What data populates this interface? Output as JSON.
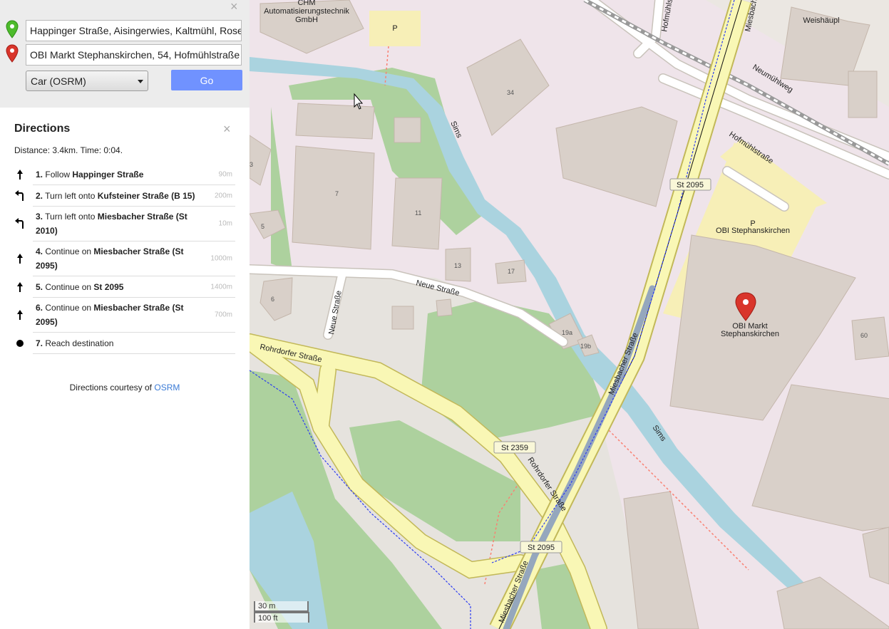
{
  "route_form": {
    "from_value": "Happinger Straße, Aisingerwies, Kaltmühl, Rosenheim",
    "to_value": "OBI Markt Stephanskirchen, 54, Hofmühlstraße",
    "engine_selected": "Car (OSRM)",
    "go_label": "Go",
    "close_symbol": "×"
  },
  "directions": {
    "title": "Directions",
    "close_symbol": "×",
    "summary": "Distance: 3.4km. Time: 0:04.",
    "steps": [
      {
        "num": "1.",
        "pre": "Follow ",
        "road": "Happinger Straße",
        "post": "",
        "distance": "90m",
        "icon": "straight-arrow-icon"
      },
      {
        "num": "2.",
        "pre": "Turn left onto ",
        "road": "Kufsteiner Straße (B 15)",
        "post": "",
        "distance": "200m",
        "icon": "turn-left-icon"
      },
      {
        "num": "3.",
        "pre": "Turn left onto ",
        "road": "Miesbacher Straße (St 2010)",
        "post": "",
        "distance": "10m",
        "icon": "turn-left-icon"
      },
      {
        "num": "4.",
        "pre": "Continue on ",
        "road": "Miesbacher Straße (St 2095)",
        "post": "",
        "distance": "1000m",
        "icon": "straight-arrow-icon"
      },
      {
        "num": "5.",
        "pre": "Continue on ",
        "road": "St 2095",
        "post": "",
        "distance": "1400m",
        "icon": "straight-arrow-icon"
      },
      {
        "num": "6.",
        "pre": "Continue on ",
        "road": "Miesbacher Straße (St 2095)",
        "post": "",
        "distance": "700m",
        "icon": "straight-arrow-icon"
      },
      {
        "num": "7.",
        "pre": "Reach destination",
        "road": "",
        "post": "",
        "distance": "",
        "icon": "destination-dot-icon"
      }
    ],
    "credit_prefix": "Directions courtesy of ",
    "credit_link": "OSRM"
  },
  "map": {
    "labels": {
      "chm_company": "CHM",
      "chm_company_2": "Automatisierungstechnik",
      "chm_company_3": "GmbH",
      "weishaupl": "Weishäupl",
      "neumuhlweg": "Neumühlweg",
      "hofmuhlstrasse": "Hofmühlstraße",
      "miesbacher_top": "Miesbacher",
      "hofmuhl_vertical": "Hofmühlstraße",
      "sims_1": "Sims",
      "sims_2": "Sims",
      "neue_strasse": "Neue Straße",
      "neue_strasse_vertical": "Neue Straße",
      "rohrdorfer_1": "Rohrdorfer Straße",
      "rohrdorfer_2": "Rohrdorfer Straße",
      "miesbacher_mid": "Miesbacher Straße",
      "miesbacher_bottom": "Miesbacher Straße",
      "obi_parking": "OBI Stephanskirchen",
      "obi_marker_1": "OBI Markt",
      "obi_marker_2": "Stephanskirchen",
      "parking_p": "P"
    },
    "badges": {
      "st2095_top": "St 2095",
      "st2359": "St 2359",
      "st2095_bottom": "St 2095"
    },
    "house_numbers": {
      "n34": "34",
      "n7": "7",
      "n11": "11",
      "n5": "5",
      "n13": "13",
      "n17": "17",
      "n6": "6",
      "n19a": "19a",
      "n19b": "19b",
      "n60": "60",
      "n3": "3"
    },
    "scale": {
      "metric": "30 m",
      "imperial": "100 ft"
    }
  }
}
